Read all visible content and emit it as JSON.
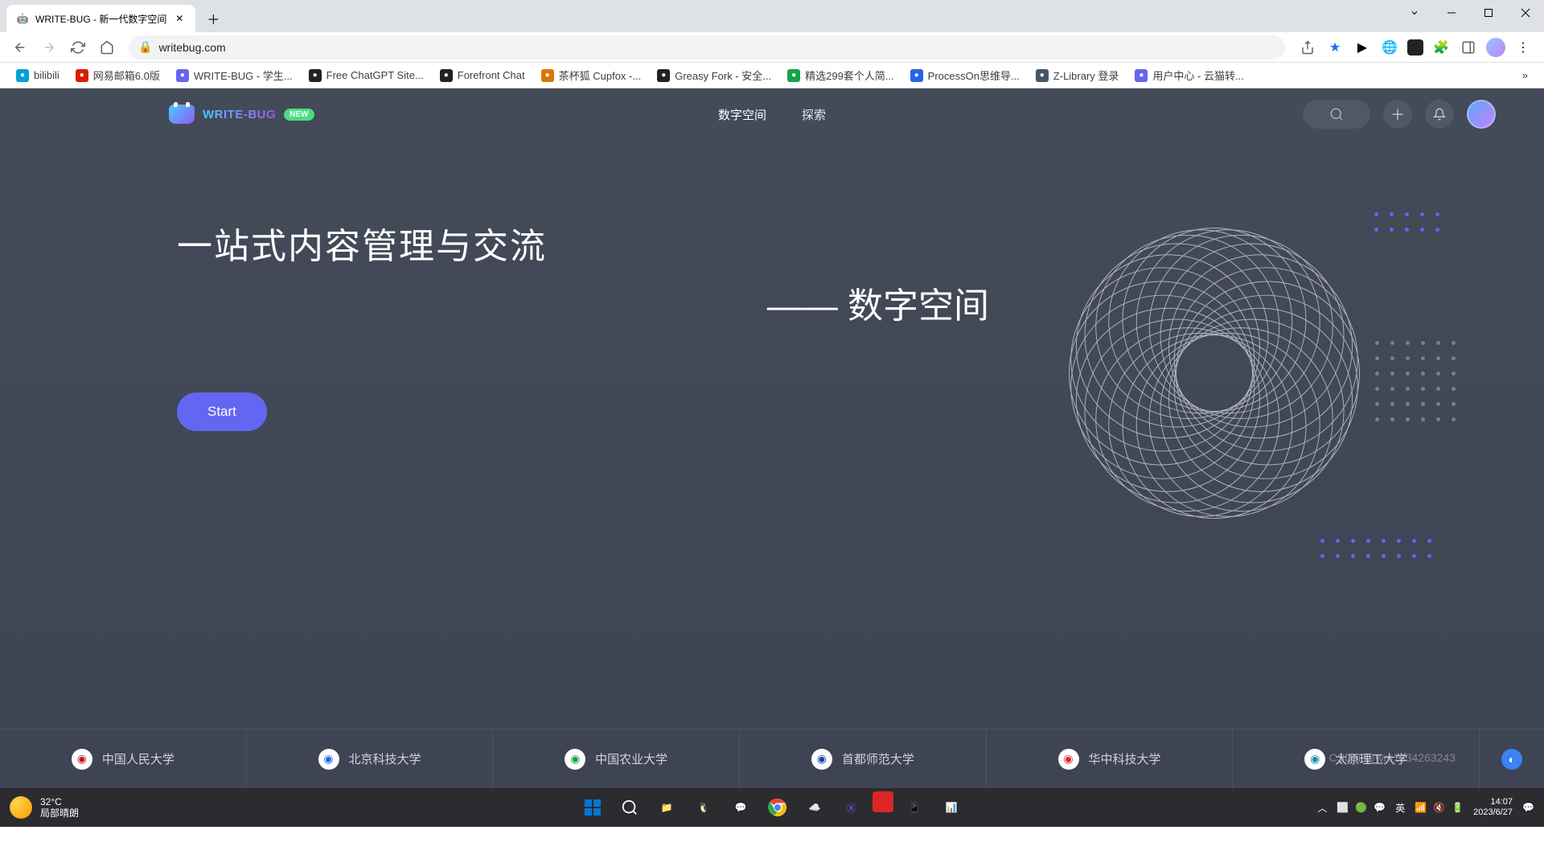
{
  "browser": {
    "tab_title": "WRITE-BUG - 新一代数字空间",
    "url": "writebug.com",
    "bookmarks": [
      {
        "label": "bilibili",
        "color": "#00a1d6"
      },
      {
        "label": "网易邮箱6.0版",
        "color": "#d81e06"
      },
      {
        "label": "WRITE-BUG - 学生...",
        "color": "#6366f1"
      },
      {
        "label": "Free ChatGPT Site...",
        "color": "#222"
      },
      {
        "label": "Forefront Chat",
        "color": "#222"
      },
      {
        "label": "茶杯狐 Cupfox -...",
        "color": "#d97706"
      },
      {
        "label": "Greasy Fork - 安全...",
        "color": "#222"
      },
      {
        "label": "精选299套个人简...",
        "color": "#16a34a"
      },
      {
        "label": "ProcessOn思维导...",
        "color": "#2563eb"
      },
      {
        "label": "Z-Library 登录",
        "color": "#475569"
      },
      {
        "label": "用户中心 - 云猫转...",
        "color": "#6366f1"
      }
    ]
  },
  "site": {
    "brand": "WRITE-BUG",
    "badge": "NEW",
    "nav": {
      "digital_space": "数字空间",
      "explore": "探索"
    },
    "hero": {
      "line1": "一站式内容管理与交流",
      "line2": "—— 数字空间",
      "start_button": "Start"
    },
    "universities": [
      "中国人民大学",
      "北京科技大学",
      "中国农业大学",
      "首都师范大学",
      "华中科技大学",
      "太原理工大学"
    ]
  },
  "taskbar": {
    "weather_temp": "32°C",
    "weather_desc": "局部晴朗",
    "ime": "英",
    "time": "14:07",
    "date": "2023/6/27"
  },
  "watermark": "CSDN @wm1834263243"
}
